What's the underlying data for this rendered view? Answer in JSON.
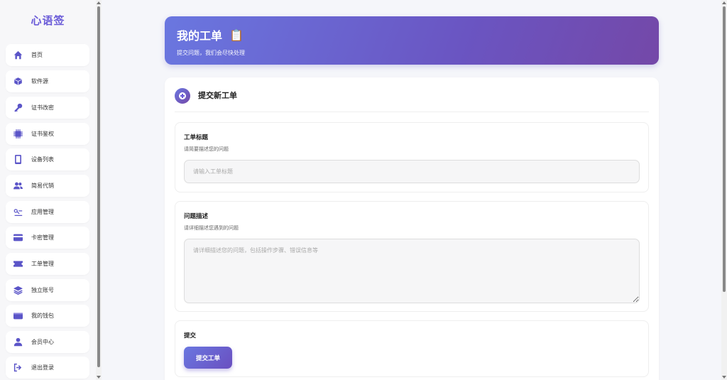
{
  "app": {
    "logo_text": "心语签",
    "accent": "#6a5bd8"
  },
  "sidebar": {
    "items": [
      {
        "label": "首页",
        "icon": "home-icon"
      },
      {
        "label": "软件源",
        "icon": "box-icon"
      },
      {
        "label": "证书改密",
        "icon": "key-icon"
      },
      {
        "label": "证书鉴权",
        "icon": "chip-icon"
      },
      {
        "label": "设备列表",
        "icon": "phone-icon"
      },
      {
        "label": "简易代销",
        "icon": "users-icon"
      },
      {
        "label": "应用管理",
        "icon": "apps-icon"
      },
      {
        "label": "卡密管理",
        "icon": "card-icon"
      },
      {
        "label": "工单管理",
        "icon": "ticket-icon"
      },
      {
        "label": "独立账号",
        "icon": "layers-icon"
      },
      {
        "label": "我的钱包",
        "icon": "wallet-icon"
      },
      {
        "label": "会员中心",
        "icon": "user-icon"
      },
      {
        "label": "退出登录",
        "icon": "logout-icon"
      }
    ]
  },
  "header": {
    "title": "我的工单",
    "emoji": "📋",
    "subtitle": "提交问题，我们会尽快处理"
  },
  "form": {
    "title": "提交新工单",
    "ticket_title": {
      "label": "工单标题",
      "hint": "请简要描述您的问题",
      "placeholder": "请输入工单标题",
      "value": ""
    },
    "description": {
      "label": "问题描述",
      "hint": "请详细描述您遇到的问题",
      "placeholder": "请详细描述您的问题，包括操作步骤、错误信息等",
      "value": ""
    },
    "submit": {
      "label": "提交",
      "button_label": "提交工单"
    }
  }
}
